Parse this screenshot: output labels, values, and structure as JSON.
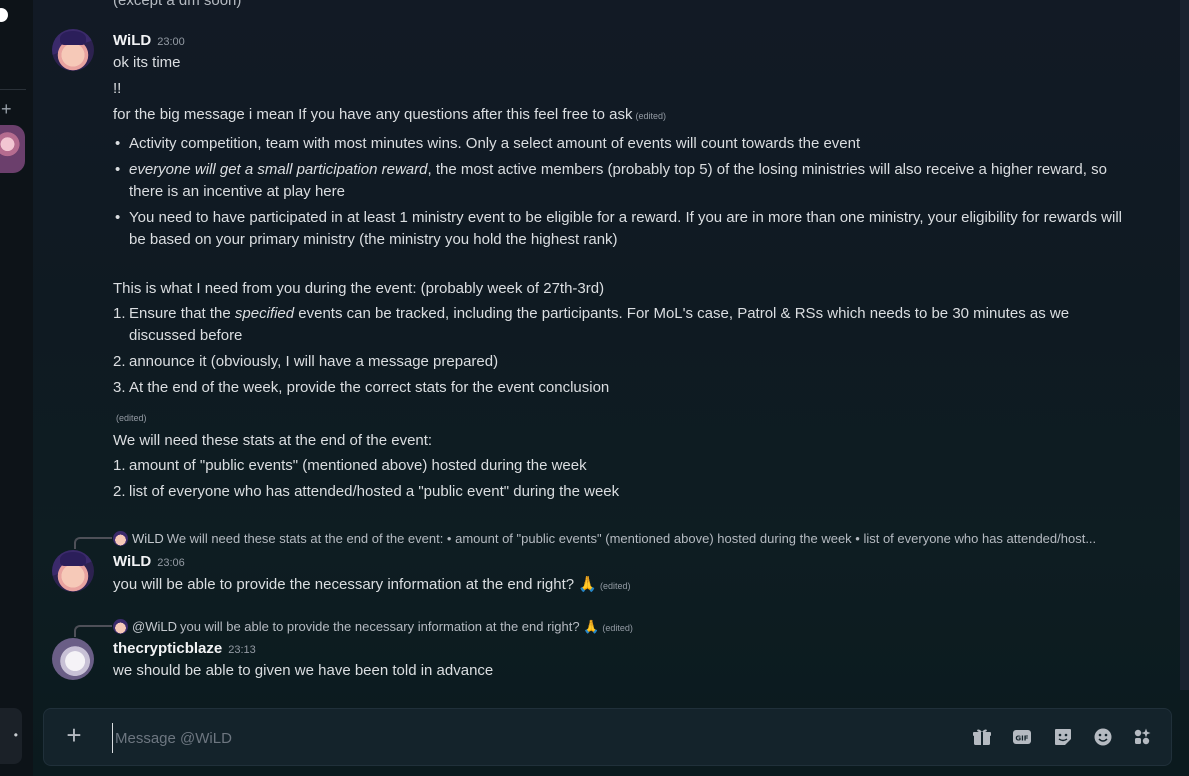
{
  "top_text": "(except a dm soon)",
  "messages": [
    {
      "username": "WiLD",
      "time": "23:00",
      "lines": [
        "ok its time",
        "!!"
      ],
      "line3": "for the big message i mean If you have any questions after this feel free to ask",
      "edited": "(edited)",
      "bullets": [
        "Activity competition, team with most minutes wins. Only a select amount of events will count towards the event",
        {
          "em": "everyone will get a small participation reward",
          "rest": ", the most active members (probably top 5) of the losing ministries will also receive a higher reward, so there is an incentive at play here"
        },
        "You need to have participated in at least 1 ministry event to be eligible for a reward. If you are in more than one ministry, your eligibility for rewards will be based on your primary ministry (the ministry you hold the highest rank)"
      ],
      "need_intro": "This is what I need from you during the event: (probably week of 27th-3rd)",
      "need_items": [
        {
          "pre": "Ensure that the ",
          "em": "specified",
          "post": " events can be tracked, including the participants. For MoL's case, Patrol & RSs which needs to be 30 minutes as we discussed before"
        },
        "announce it (obviously, I will have a message prepared)",
        "At the end of the week, provide the correct stats for the event conclusion"
      ],
      "edited2": "(edited)",
      "stats_intro": "We will need these stats at the end of the event:",
      "stats_items": [
        "amount of \"public events\" (mentioned above) hosted during the week",
        "list of everyone who has attended/hosted a \"public event\" during the week"
      ]
    },
    {
      "reply_name": "WiLD",
      "reply_text": "We will need these stats at the end of the event: • amount of \"public events\" (mentioned above) hosted during the week  • list of everyone who has attended/host...",
      "username": "WiLD",
      "time": "23:06",
      "text": "you will be able to provide the necessary information at the end right? 🙏",
      "edited": "(edited)"
    },
    {
      "reply_name": "@WiLD",
      "reply_text": "you will be able to provide the necessary information at the end right? 🙏",
      "reply_edited": "(edited)",
      "username": "thecrypticblaze",
      "time": "23:13",
      "text": "we should be able to given we have been told in advance"
    }
  ],
  "composer": {
    "placeholder": "Message @WiLD",
    "tools": [
      "gift-icon",
      "gif-icon",
      "sticker-icon",
      "emoji-icon",
      "apps-icon"
    ]
  }
}
